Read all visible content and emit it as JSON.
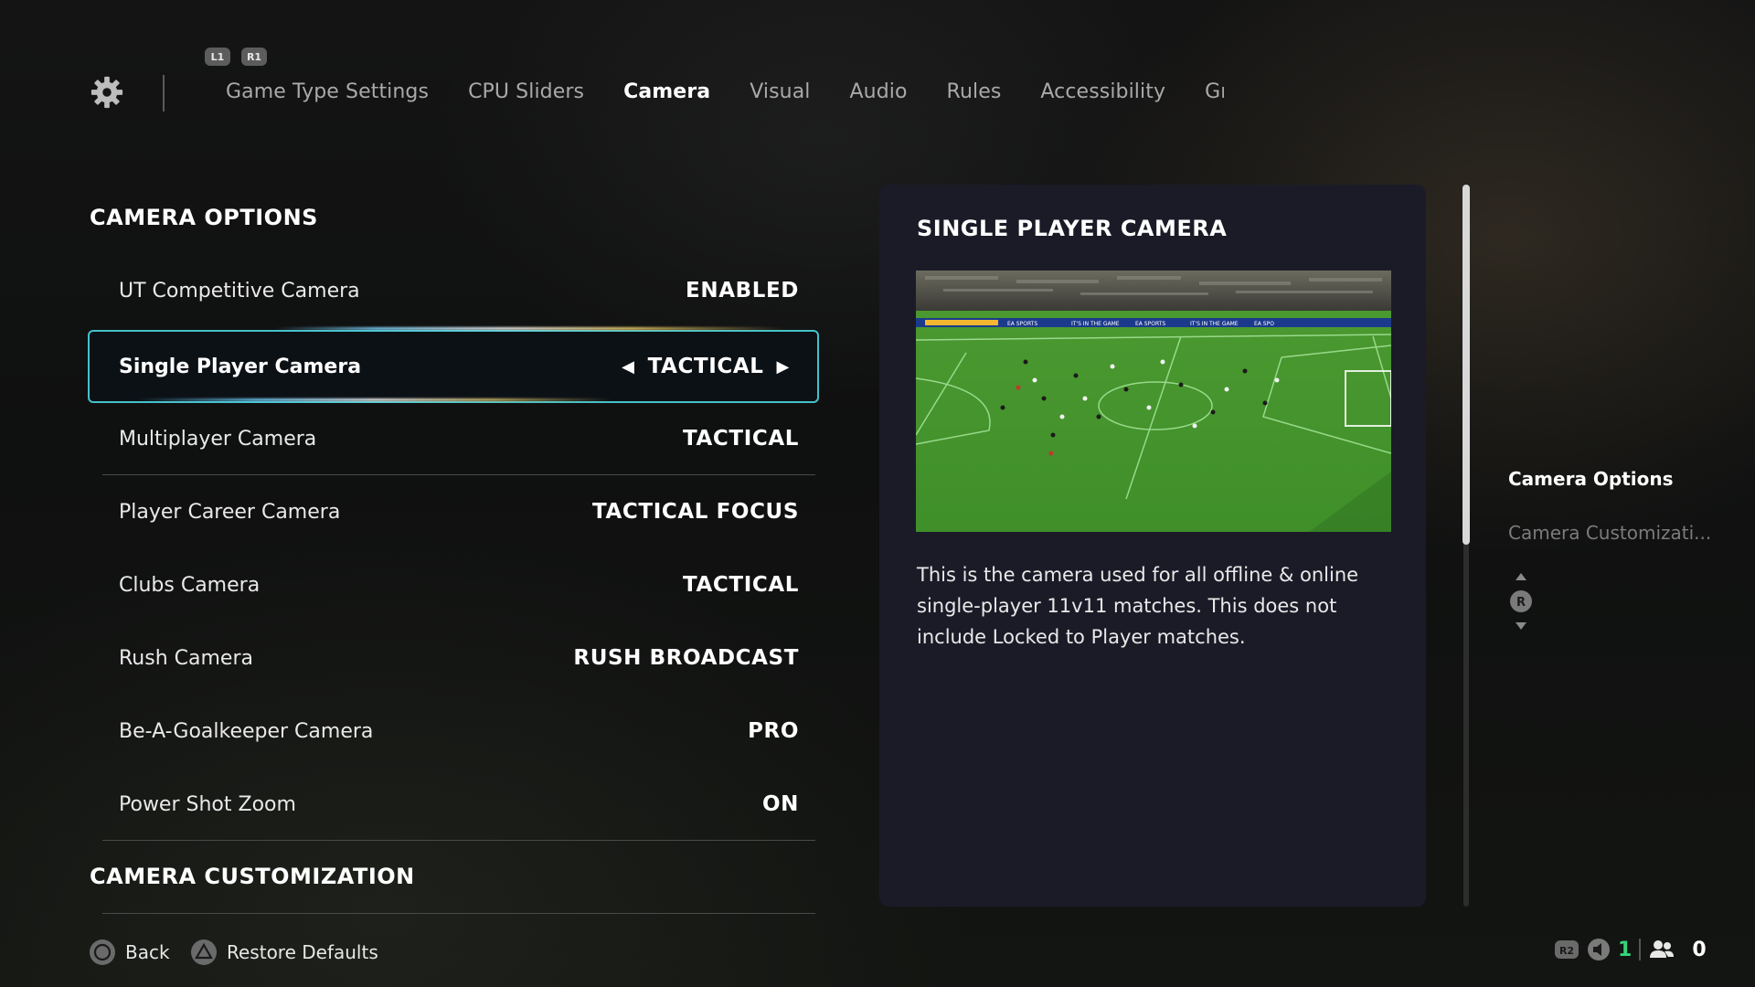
{
  "header": {
    "shoulder_left": "L1",
    "shoulder_right": "R1",
    "tabs": [
      {
        "label": "Game Type Settings",
        "active": false
      },
      {
        "label": "CPU Sliders",
        "active": false
      },
      {
        "label": "Camera",
        "active": true
      },
      {
        "label": "Visual",
        "active": false
      },
      {
        "label": "Audio",
        "active": false
      },
      {
        "label": "Rules",
        "active": false
      },
      {
        "label": "Accessibility",
        "active": false
      },
      {
        "label": "Graphic",
        "active": false
      }
    ]
  },
  "camera_options": {
    "heading": "CAMERA OPTIONS",
    "rows": [
      {
        "label": "UT Competitive Camera",
        "value": "ENABLED"
      },
      {
        "label": "Single Player Camera",
        "value": "TACTICAL"
      },
      {
        "label": "Multiplayer Camera",
        "value": "TACTICAL"
      },
      {
        "label": "Player Career Camera",
        "value": "TACTICAL FOCUS"
      },
      {
        "label": "Clubs Camera",
        "value": "TACTICAL"
      },
      {
        "label": "Rush Camera",
        "value": "RUSH BROADCAST"
      },
      {
        "label": "Be-A-Goalkeeper Camera",
        "value": "PRO"
      },
      {
        "label": "Power Shot Zoom",
        "value": "ON"
      }
    ],
    "selected_index": 1
  },
  "camera_customization": {
    "heading": "CAMERA CUSTOMIZATION"
  },
  "info_panel": {
    "title": "SINGLE PLAYER CAMERA",
    "description": "This is the camera used for all offline & online single-player 11v11 matches. This does not include Locked to Player matches."
  },
  "right_nav": {
    "items": [
      {
        "label": "Camera Options",
        "active": true
      },
      {
        "label": "Camera Customizati...",
        "active": false
      }
    ],
    "stick_label": "R"
  },
  "footer": {
    "back_label": "Back",
    "restore_label": "Restore Defaults",
    "r2_label": "R2",
    "count_green": "1",
    "count_white": "0"
  },
  "colors": {
    "accent": "#45c1c9",
    "panel_bg": "#1b1b28",
    "green_count": "#34d47a",
    "pitch": "#3f8f2a"
  },
  "icons": [
    "gear-icon",
    "circle-button-icon",
    "triangle-button-icon",
    "r-stick-icon",
    "speaker-icon",
    "friends-icon"
  ]
}
